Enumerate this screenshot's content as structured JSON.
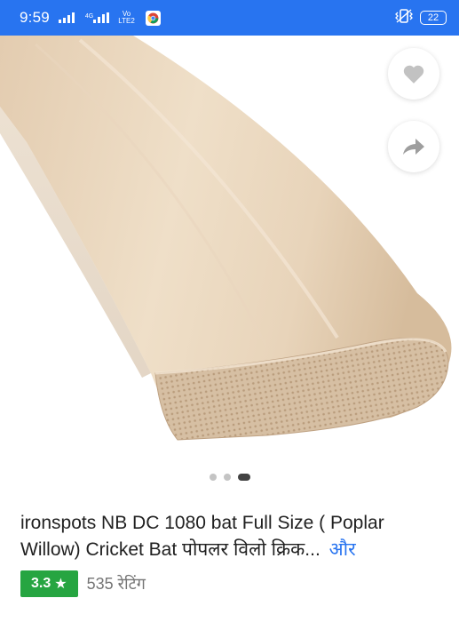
{
  "status_bar": {
    "time": "9:59",
    "net_type": "4G",
    "volte_top": "Vo",
    "volte_bottom": "LTE",
    "volte_sub": "2",
    "battery": "22",
    "icons": [
      "signal-icon",
      "chrome-icon",
      "vibrate-icon",
      "battery-icon"
    ]
  },
  "product": {
    "image_alt": "cricket bat",
    "carousel": {
      "total": 3,
      "active": 3
    },
    "title": "ironspots NB DC 1080 bat Full Size ( Poplar Willow) Cricket Bat पोपलर विलो क्रिक...",
    "more_label": "और",
    "rating": {
      "value": "3.3",
      "star": "★"
    },
    "ratings_count": "535 रेटिंग"
  },
  "actions": {
    "wishlist_icon": "heart-icon",
    "share_icon": "share-icon"
  },
  "colors": {
    "status_bar": "#2874f0",
    "rating_badge": "#26a541",
    "link": "#2874f0"
  }
}
